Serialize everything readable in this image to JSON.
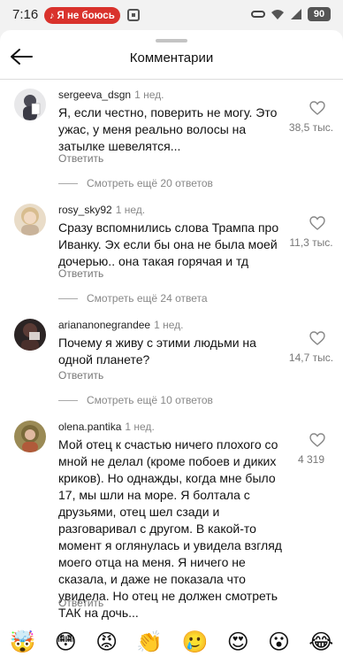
{
  "status_bar": {
    "time": "7:16",
    "recording_label": "Я не боюсь",
    "battery": "90"
  },
  "header": {
    "title": "Комментарии"
  },
  "comments": [
    {
      "username": "sergeeva_dsgn",
      "time": "1 нед.",
      "text": "Я, если честно, поверить не могу. Это ужас, у меня реально волосы на затылке шевелятся...",
      "reply_label": "Ответить",
      "likes": "38,5 тыс.",
      "view_replies": "Смотреть ещё 20 ответов"
    },
    {
      "username": "rosy_sky92",
      "time": "1 нед.",
      "text": "Сразу вспомнились слова Трампа про Иванку. Эх если бы она не была моей дочерью.. она такая горячая и тд",
      "reply_label": "Ответить",
      "likes": "11,3 тыс.",
      "view_replies": "Смотреть ещё 24 ответа"
    },
    {
      "username": "ariananonegrandee",
      "time": "1 нед.",
      "text": "Почему я живу с этими людьми на одной планете?",
      "reply_label": "Ответить",
      "likes": "14,7 тыс.",
      "view_replies": "Смотреть ещё 10 ответов"
    },
    {
      "username": "olena.pantika",
      "time": "1 нед.",
      "text": "Мой отец к счастью ничего плохого со мной не делал (кроме побоев и диких криков). Но однажды, когда мне было 17, мы шли на море. Я болтала с друзьями, отец шел сзади и разговаривал с другом. В какой-то момент я оглянулась и увидела взгляд моего отца на меня. Я ничего не сказала, и даже не показала что увидела. Но отец не должен смотреть ТАК на дочь...",
      "reply_label": "Ответить",
      "likes": "4 319"
    }
  ],
  "reactions": [
    "🤯",
    "😳",
    "😡",
    "👏",
    "🥲",
    "😍",
    "😮",
    "😂"
  ]
}
